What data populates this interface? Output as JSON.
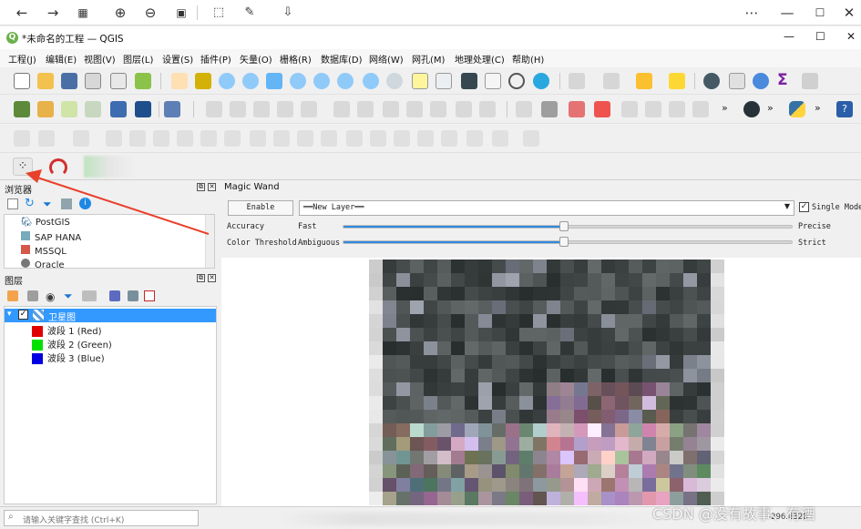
{
  "window": {
    "title": "*未命名的工程 — QGIS"
  },
  "menubar": {
    "items": [
      {
        "label": "工程(J)"
      },
      {
        "label": "编辑(E)"
      },
      {
        "label": "视图(V)"
      },
      {
        "label": "图层(L)"
      },
      {
        "label": "设置(S)"
      },
      {
        "label": "插件(P)"
      },
      {
        "label": "矢量(O)"
      },
      {
        "label": "栅格(R)"
      },
      {
        "label": "数据库(D)"
      },
      {
        "label": "网络(W)"
      },
      {
        "label": "网孔(M)"
      },
      {
        "label": "地理处理(C)"
      },
      {
        "label": "帮助(H)"
      }
    ]
  },
  "browser_panel": {
    "title": "浏览器",
    "items": [
      {
        "label": "PostGIS"
      },
      {
        "label": "SAP HANA"
      },
      {
        "label": "MSSQL"
      },
      {
        "label": "Oracle"
      }
    ]
  },
  "layers_panel": {
    "title": "图层",
    "root_layer": "卫星图",
    "bands": [
      {
        "label": "波段 1 (Red)",
        "color": "#e00000"
      },
      {
        "label": "波段 2 (Green)",
        "color": "#00e000"
      },
      {
        "label": "波段 3 (Blue)",
        "color": "#0000e0"
      }
    ]
  },
  "magic_wand": {
    "title": "Magic Wand",
    "enable_label": "Enable",
    "layer_select": "══New Layer══",
    "single_mode_label": "Single Mode",
    "single_mode_checked": true,
    "accuracy": {
      "label": "Accuracy",
      "left": "Fast",
      "right": "Precise",
      "value": 0.49
    },
    "threshold": {
      "label": "Color Threshold",
      "left": "Ambiguous",
      "right": "Strict",
      "value": 0.49
    }
  },
  "statusbar": {
    "search_placeholder": "请输入关键字查找 (Ctrl+K)",
    "coordinate": "-296.4328"
  },
  "watermark": "CSDN @没有故事、有酒",
  "icons": {
    "viewer": [
      "back-arrow-icon",
      "forward-arrow-icon",
      "grid-icon",
      "zoom-in-icon",
      "zoom-out-icon",
      "fit-icon",
      "rotate-icon",
      "edit-icon",
      "save-icon",
      "more-icon",
      "minimize-icon",
      "maximize-icon",
      "close-icon"
    ]
  },
  "colors": {
    "accent": "#2f8ae0",
    "selection": "#3399ff",
    "annotation_arrow": "#e8412c"
  }
}
